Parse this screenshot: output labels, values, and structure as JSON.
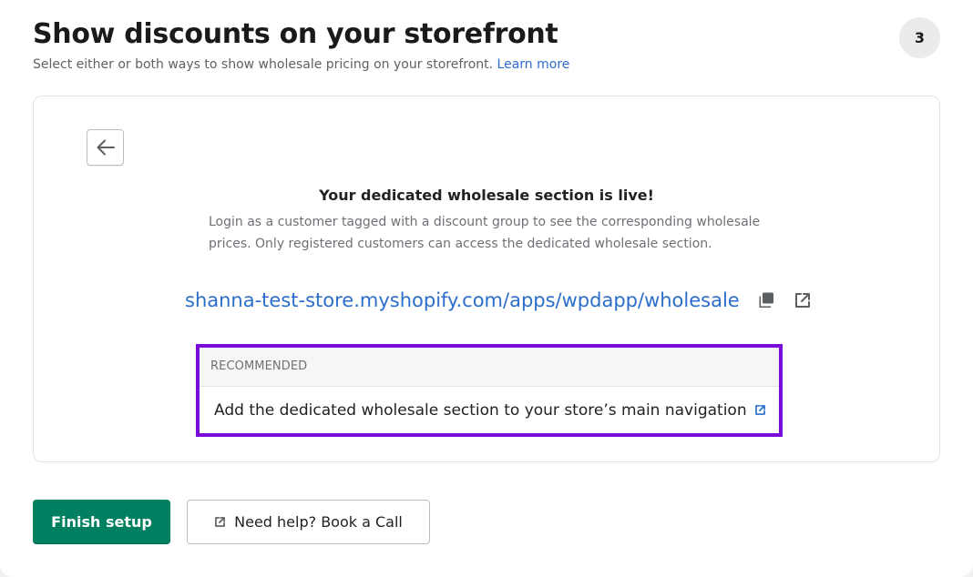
{
  "header": {
    "title": "Show discounts on your storefront",
    "subtitle": "Select either or both ways to show wholesale pricing on your storefront.",
    "learn_more": "Learn more",
    "step_number": "3"
  },
  "card": {
    "back_icon": "arrow-left-icon",
    "heading": "Your dedicated wholesale section is live!",
    "description": "Login as a customer tagged with a discount group to see the corresponding wholesale prices. Only registered customers can access the dedicated wholesale section.",
    "url": "shanna-test-store.myshopify.com/apps/wpdapp/wholesale",
    "copy_icon": "copy-icon",
    "external_icon": "external-link-icon",
    "recommended": {
      "label": "RECOMMENDED",
      "item_label": "Add the dedicated wholesale section to your store’s main navigation",
      "item_icon": "external-link-icon",
      "highlight_color": "#7a0cd9"
    }
  },
  "actions": {
    "primary_label": "Finish setup",
    "secondary_label": "Need help? Book a Call",
    "secondary_icon": "external-link-icon"
  },
  "colors": {
    "primary_button": "#008060",
    "link": "#2c6ecb"
  }
}
